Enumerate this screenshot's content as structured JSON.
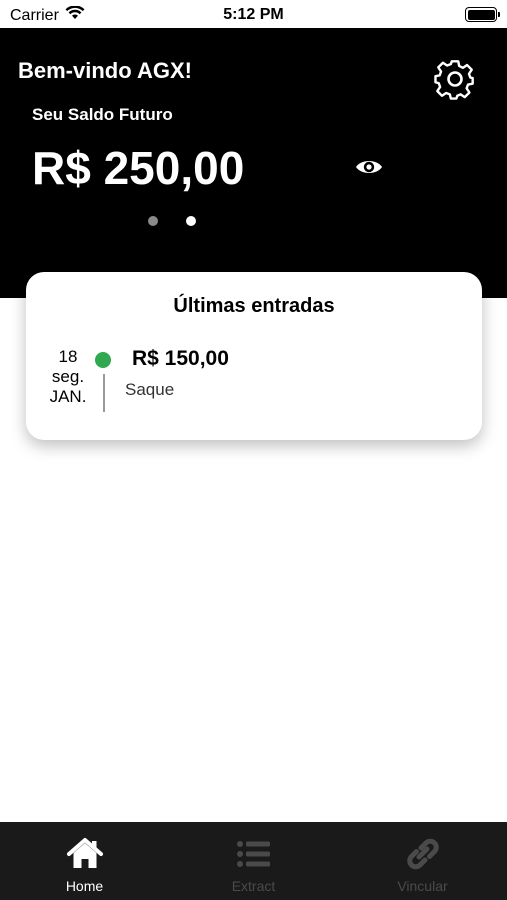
{
  "status_bar": {
    "carrier": "Carrier",
    "time": "5:12 PM"
  },
  "header": {
    "welcome": "Bem-vindo AGX!",
    "balance_label": "Seu Saldo Futuro",
    "balance_value": "R$ 250,00",
    "settings_icon": "gear-icon",
    "visibility_icon": "eye-icon",
    "pager": {
      "pages": 2,
      "active_index": 1
    }
  },
  "recent_entries": {
    "title": "Últimas entradas",
    "items": [
      {
        "day": "18",
        "weekday": "seg.",
        "month": "JAN.",
        "amount": "R$ 150,00",
        "description": "Saque",
        "status_color": "#2fa84f"
      }
    ]
  },
  "tab_bar": {
    "tabs": [
      {
        "label": "Home",
        "icon": "home-icon",
        "active": true
      },
      {
        "label": "Extract",
        "icon": "list-icon",
        "active": false
      },
      {
        "label": "Vincular",
        "icon": "link-icon",
        "active": false
      }
    ]
  },
  "colors": {
    "header_background": "#000000",
    "tab_bar_background": "#1a1a1a",
    "active_tab": "#ffffff",
    "inactive_tab": "#4a4a4a",
    "entry_status": "#2fa84f"
  }
}
